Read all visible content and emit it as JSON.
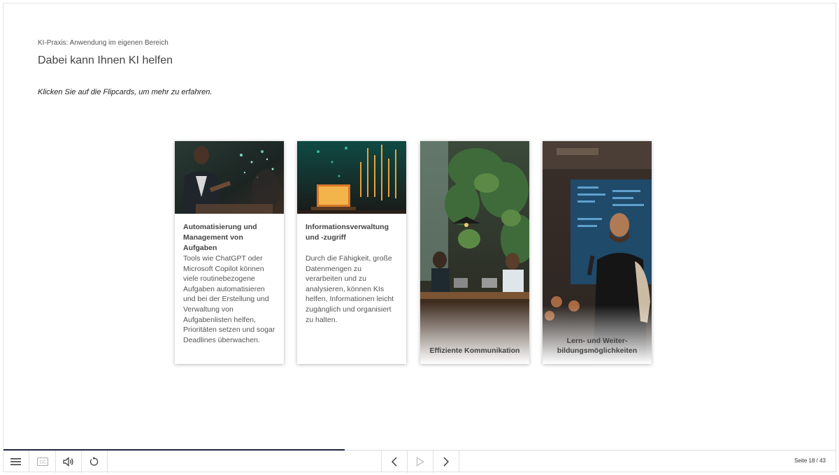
{
  "header": {
    "breadcrumb": "KI-Praxis: Anwendung im eigenen Bereich",
    "title": "Dabei kann Ihnen KI helfen",
    "instruction": "Klicken Sie auf die Flipcards, um mehr zu erfahren."
  },
  "cards": [
    {
      "title": "Automatisierung und Management von Aufgaben",
      "body": "Tools wie ChatGPT oder Microsoft Copilot können viele routinebezogene Aufgaben automatisieren und bei der Erstellung und Verwaltung von Aufgabenlisten helfen, Prioritäten setzen und sogar Deadlines überwachen."
    },
    {
      "title": "Informationsverwaltung und -zugriff",
      "body": "Durch die Fähigkeit, große Datenmengen zu verarbeiten und zu analysieren, können KIs helfen, Informationen leicht zugänglich und organisiert zu halten."
    },
    {
      "caption": "Effiziente Kommunikation"
    },
    {
      "caption": "Lern- und Weiter-bildungsmöglichkeiten"
    }
  ],
  "footer": {
    "page_counter": "Seite 18 / 43",
    "progress_fraction": 0.41,
    "icons": [
      "menu-icon",
      "cc-icon",
      "volume-icon",
      "replay-icon",
      "prev-icon",
      "play-icon",
      "next-icon"
    ]
  }
}
